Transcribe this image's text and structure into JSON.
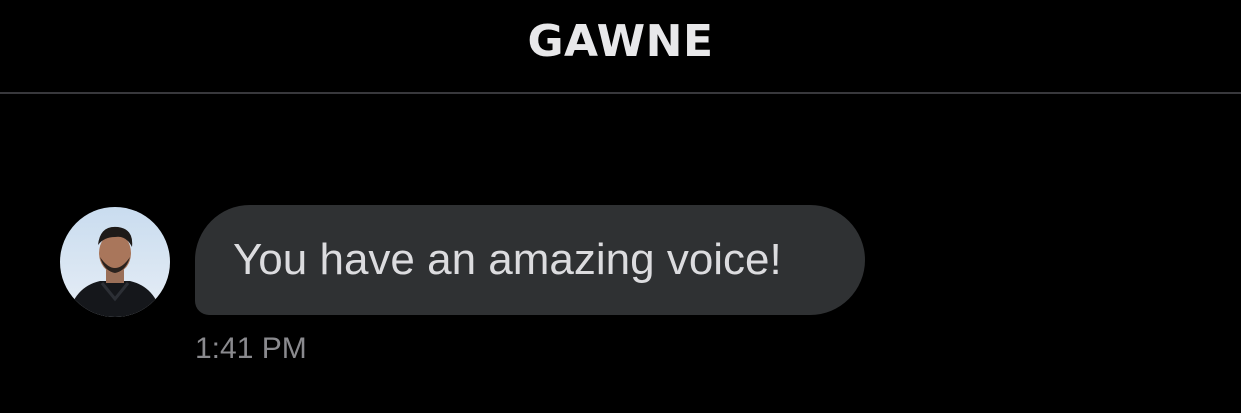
{
  "header": {
    "title": "GAWNE"
  },
  "conversation": {
    "messages": [
      {
        "sender_avatar": "profile-photo",
        "text": "You have an amazing voice!",
        "time": "1:41 PM"
      }
    ]
  },
  "colors": {
    "background": "#000000",
    "bubble": "#2f3133",
    "divider": "#38383c",
    "title_text": "#e8e8ea",
    "message_text": "#dcdcdf",
    "timestamp_text": "#8a8a8e"
  }
}
